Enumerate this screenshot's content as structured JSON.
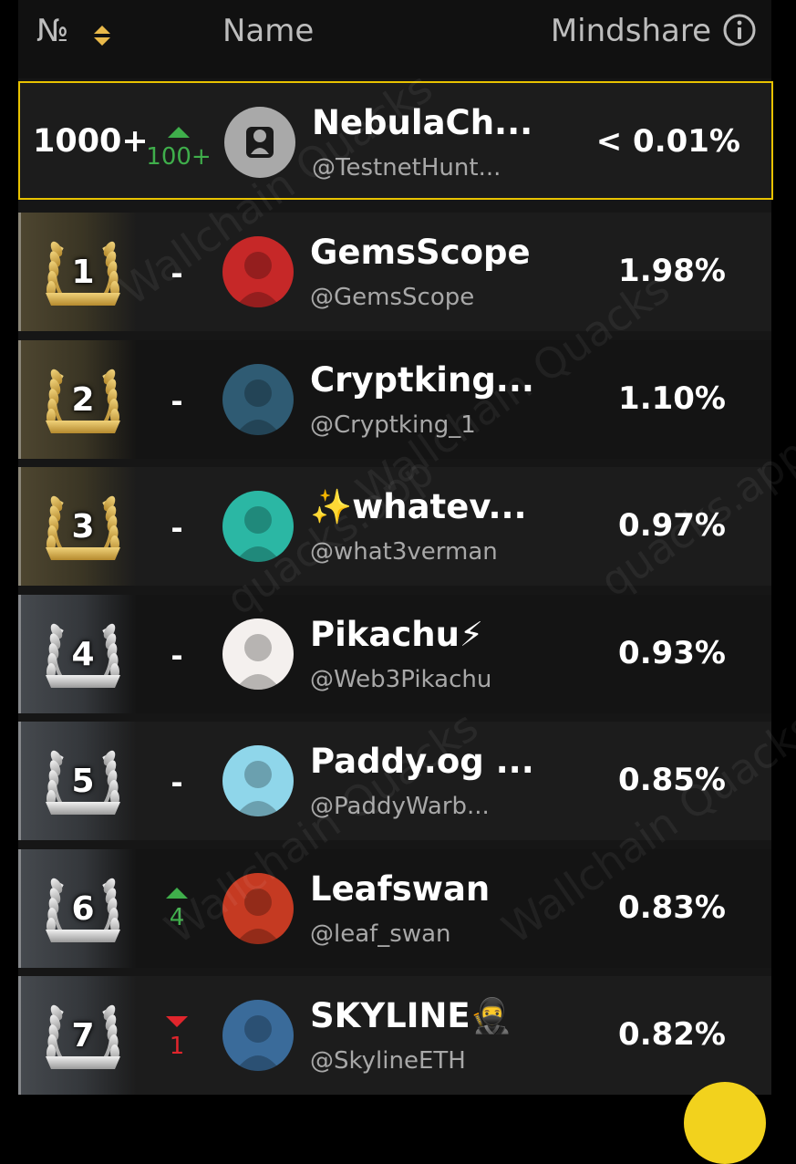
{
  "header": {
    "num_label": "№",
    "name_label": "Name",
    "mindshare_label": "Mindshare"
  },
  "watermark": "Wallchain Quacks",
  "watermark2": "quacks.app",
  "current_user": {
    "rank": "1000+",
    "change": "100+",
    "change_dir": "up",
    "name": "NebulaCh...",
    "handle": "@TestnetHunt...",
    "mindshare": "< 0.01%"
  },
  "rows": [
    {
      "rank": "1",
      "tier": "gold",
      "change": "-",
      "change_dir": "none",
      "name": "GemsScope",
      "handle": "@GemsScope",
      "mindshare": "1.98%",
      "avatar_color": "#c62828"
    },
    {
      "rank": "2",
      "tier": "gold",
      "change": "-",
      "change_dir": "none",
      "name": "Cryptking...",
      "handle": "@Cryptking_1",
      "mindshare": "1.10%",
      "avatar_color": "#2f5b73"
    },
    {
      "rank": "3",
      "tier": "gold",
      "change": "-",
      "change_dir": "none",
      "name": "✨whatev...",
      "handle": "@what3verman",
      "mindshare": "0.97%",
      "avatar_color": "#2bb7a4"
    },
    {
      "rank": "4",
      "tier": "silver",
      "change": "-",
      "change_dir": "none",
      "name": "Pikachu⚡",
      "handle": "@Web3Pikachu",
      "mindshare": "0.93%",
      "avatar_color": "#f4f0ee"
    },
    {
      "rank": "5",
      "tier": "silver",
      "change": "-",
      "change_dir": "none",
      "name": "Paddy.og ...",
      "handle": "@PaddyWarb...",
      "mindshare": "0.85%",
      "avatar_color": "#8fd6ea"
    },
    {
      "rank": "6",
      "tier": "silver",
      "change": "4",
      "change_dir": "up",
      "name": "Leafswan",
      "handle": "@leaf_swan",
      "mindshare": "0.83%",
      "avatar_color": "#c53a22"
    },
    {
      "rank": "7",
      "tier": "silver",
      "change": "1",
      "change_dir": "down",
      "name": "SKYLINE🥷",
      "handle": "@SkylineETH",
      "mindshare": "0.82%",
      "avatar_color": "#3a6b9a"
    }
  ],
  "colors": {
    "accent": "#e8c200",
    "up": "#3fae4b",
    "down": "#e0252c"
  }
}
